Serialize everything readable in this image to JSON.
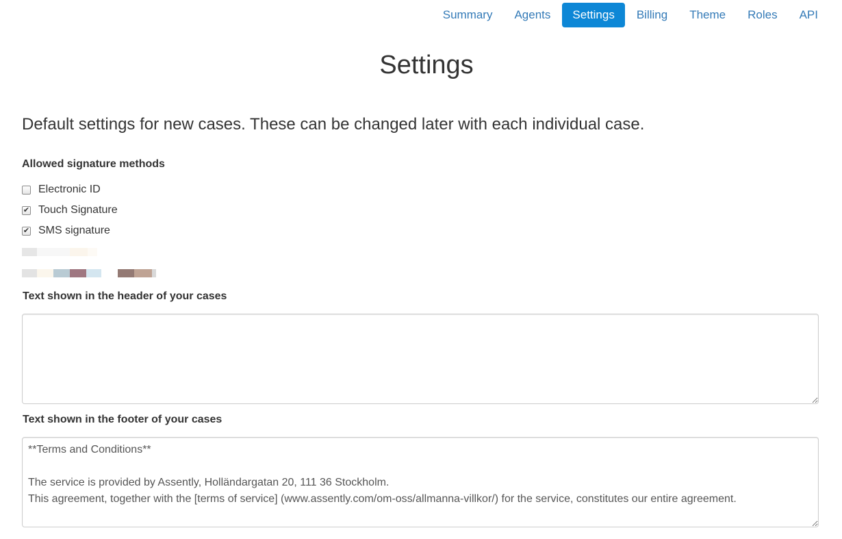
{
  "nav": {
    "items": [
      {
        "label": "Summary",
        "active": false
      },
      {
        "label": "Agents",
        "active": false
      },
      {
        "label": "Settings",
        "active": true
      },
      {
        "label": "Billing",
        "active": false
      },
      {
        "label": "Theme",
        "active": false
      },
      {
        "label": "Roles",
        "active": false
      },
      {
        "label": "API",
        "active": false
      }
    ],
    "active_color": "#0d87d6",
    "link_color": "#337ab7"
  },
  "page": {
    "title": "Settings",
    "lead": "Default settings for new cases. These can be changed later with each individual case."
  },
  "signature_methods": {
    "label": "Allowed signature methods",
    "options": [
      {
        "label": "Electronic ID",
        "checked": false
      },
      {
        "label": "Touch Signature",
        "checked": true
      },
      {
        "label": "SMS signature",
        "checked": true
      }
    ]
  },
  "header_text": {
    "label": "Text shown in the header of your cases",
    "value": ""
  },
  "footer_text": {
    "label": "Text shown in the footer of your cases",
    "value": "**Terms and Conditions**\n\nThe service is provided by Assently, Holländargatan 20, 111 36 Stockholm.\nThis agreement, together with the [terms of service] (www.assently.com/om-oss/allmanna-villkor/) for the service, constitutes our entire agreement."
  }
}
